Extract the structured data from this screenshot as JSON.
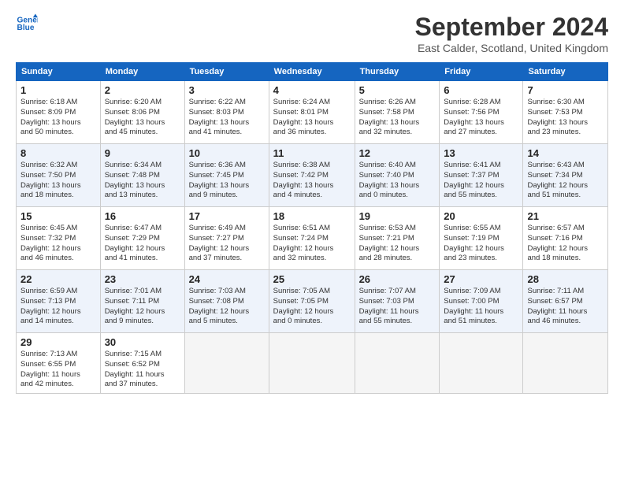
{
  "header": {
    "logo_line1": "General",
    "logo_line2": "Blue",
    "title": "September 2024",
    "location": "East Calder, Scotland, United Kingdom"
  },
  "weekdays": [
    "Sunday",
    "Monday",
    "Tuesday",
    "Wednesday",
    "Thursday",
    "Friday",
    "Saturday"
  ],
  "weeks": [
    [
      {
        "day": "1",
        "info": "Sunrise: 6:18 AM\nSunset: 8:09 PM\nDaylight: 13 hours\nand 50 minutes."
      },
      {
        "day": "2",
        "info": "Sunrise: 6:20 AM\nSunset: 8:06 PM\nDaylight: 13 hours\nand 45 minutes."
      },
      {
        "day": "3",
        "info": "Sunrise: 6:22 AM\nSunset: 8:03 PM\nDaylight: 13 hours\nand 41 minutes."
      },
      {
        "day": "4",
        "info": "Sunrise: 6:24 AM\nSunset: 8:01 PM\nDaylight: 13 hours\nand 36 minutes."
      },
      {
        "day": "5",
        "info": "Sunrise: 6:26 AM\nSunset: 7:58 PM\nDaylight: 13 hours\nand 32 minutes."
      },
      {
        "day": "6",
        "info": "Sunrise: 6:28 AM\nSunset: 7:56 PM\nDaylight: 13 hours\nand 27 minutes."
      },
      {
        "day": "7",
        "info": "Sunrise: 6:30 AM\nSunset: 7:53 PM\nDaylight: 13 hours\nand 23 minutes."
      }
    ],
    [
      {
        "day": "8",
        "info": "Sunrise: 6:32 AM\nSunset: 7:50 PM\nDaylight: 13 hours\nand 18 minutes."
      },
      {
        "day": "9",
        "info": "Sunrise: 6:34 AM\nSunset: 7:48 PM\nDaylight: 13 hours\nand 13 minutes."
      },
      {
        "day": "10",
        "info": "Sunrise: 6:36 AM\nSunset: 7:45 PM\nDaylight: 13 hours\nand 9 minutes."
      },
      {
        "day": "11",
        "info": "Sunrise: 6:38 AM\nSunset: 7:42 PM\nDaylight: 13 hours\nand 4 minutes."
      },
      {
        "day": "12",
        "info": "Sunrise: 6:40 AM\nSunset: 7:40 PM\nDaylight: 13 hours\nand 0 minutes."
      },
      {
        "day": "13",
        "info": "Sunrise: 6:41 AM\nSunset: 7:37 PM\nDaylight: 12 hours\nand 55 minutes."
      },
      {
        "day": "14",
        "info": "Sunrise: 6:43 AM\nSunset: 7:34 PM\nDaylight: 12 hours\nand 51 minutes."
      }
    ],
    [
      {
        "day": "15",
        "info": "Sunrise: 6:45 AM\nSunset: 7:32 PM\nDaylight: 12 hours\nand 46 minutes."
      },
      {
        "day": "16",
        "info": "Sunrise: 6:47 AM\nSunset: 7:29 PM\nDaylight: 12 hours\nand 41 minutes."
      },
      {
        "day": "17",
        "info": "Sunrise: 6:49 AM\nSunset: 7:27 PM\nDaylight: 12 hours\nand 37 minutes."
      },
      {
        "day": "18",
        "info": "Sunrise: 6:51 AM\nSunset: 7:24 PM\nDaylight: 12 hours\nand 32 minutes."
      },
      {
        "day": "19",
        "info": "Sunrise: 6:53 AM\nSunset: 7:21 PM\nDaylight: 12 hours\nand 28 minutes."
      },
      {
        "day": "20",
        "info": "Sunrise: 6:55 AM\nSunset: 7:19 PM\nDaylight: 12 hours\nand 23 minutes."
      },
      {
        "day": "21",
        "info": "Sunrise: 6:57 AM\nSunset: 7:16 PM\nDaylight: 12 hours\nand 18 minutes."
      }
    ],
    [
      {
        "day": "22",
        "info": "Sunrise: 6:59 AM\nSunset: 7:13 PM\nDaylight: 12 hours\nand 14 minutes."
      },
      {
        "day": "23",
        "info": "Sunrise: 7:01 AM\nSunset: 7:11 PM\nDaylight: 12 hours\nand 9 minutes."
      },
      {
        "day": "24",
        "info": "Sunrise: 7:03 AM\nSunset: 7:08 PM\nDaylight: 12 hours\nand 5 minutes."
      },
      {
        "day": "25",
        "info": "Sunrise: 7:05 AM\nSunset: 7:05 PM\nDaylight: 12 hours\nand 0 minutes."
      },
      {
        "day": "26",
        "info": "Sunrise: 7:07 AM\nSunset: 7:03 PM\nDaylight: 11 hours\nand 55 minutes."
      },
      {
        "day": "27",
        "info": "Sunrise: 7:09 AM\nSunset: 7:00 PM\nDaylight: 11 hours\nand 51 minutes."
      },
      {
        "day": "28",
        "info": "Sunrise: 7:11 AM\nSunset: 6:57 PM\nDaylight: 11 hours\nand 46 minutes."
      }
    ],
    [
      {
        "day": "29",
        "info": "Sunrise: 7:13 AM\nSunset: 6:55 PM\nDaylight: 11 hours\nand 42 minutes."
      },
      {
        "day": "30",
        "info": "Sunrise: 7:15 AM\nSunset: 6:52 PM\nDaylight: 11 hours\nand 37 minutes."
      },
      null,
      null,
      null,
      null,
      null
    ]
  ]
}
